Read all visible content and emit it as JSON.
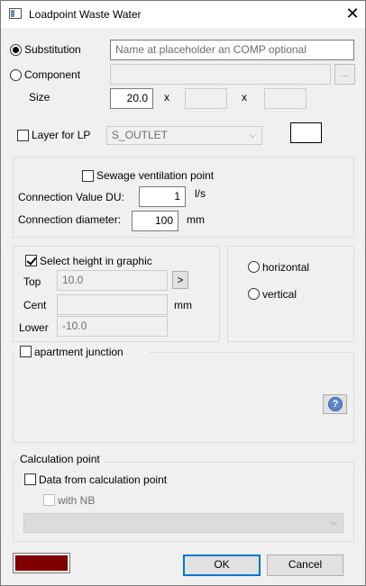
{
  "window": {
    "title": "Loadpoint Waste Water",
    "close_glyph": "✕"
  },
  "mode": {
    "substitution_label": "Substitution",
    "substitution_value": "Name at placeholder an COMP optional",
    "component_label": "Component",
    "browse_label": "...",
    "size_label": "Size",
    "size_value": "20.0",
    "x1": "x",
    "x2": "x"
  },
  "layer": {
    "label": "Layer for LP",
    "value": "S_OUTLET"
  },
  "ventilation": {
    "sewage_label": "Sewage ventilation point",
    "du_label": "Connection Value DU:",
    "du_value": "1",
    "du_unit": "l/s",
    "diam_label": "Connection diameter:",
    "diam_value": "100",
    "diam_unit": "mm"
  },
  "height": {
    "select_label": "Select height in graphic",
    "top_label": "Top",
    "top_value": "10.0",
    "arrow_label": ">",
    "cent_label": "Cent",
    "mm": "mm",
    "lower_label": "Lower",
    "lower_value": "-10.0"
  },
  "orientation": {
    "horizontal": "horizontal",
    "vertical": "vertical"
  },
  "apartment": {
    "label": "apartment junction",
    "help_glyph": "?"
  },
  "calc": {
    "group_label": "Calculation point",
    "data_label": "Data from calculation point",
    "nb_label": "with NB"
  },
  "footer": {
    "ok": "OK",
    "cancel": "Cancel"
  },
  "colors": {
    "swatch": "#800000",
    "accent": "#0078d7"
  }
}
